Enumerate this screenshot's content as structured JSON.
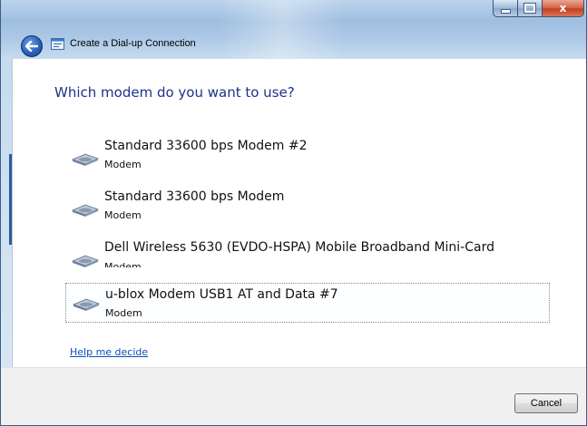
{
  "window": {
    "title": "Create a Dial-up Connection",
    "close_glyph": "x",
    "icons": [
      "back-arrow-icon",
      "network-connection-icon",
      "minimize-icon",
      "maximize-icon",
      "close-icon"
    ]
  },
  "main": {
    "heading": "Which modem do you want to use?",
    "modems": [
      {
        "name": "Standard 33600 bps Modem #2",
        "type": "Modem",
        "selected": false
      },
      {
        "name": "Standard 33600 bps Modem",
        "type": "Modem",
        "selected": false
      },
      {
        "name": "Dell Wireless 5630 (EVDO-HSPA) Mobile Broadband Mini-Card",
        "type": "Modem",
        "selected": false
      },
      {
        "name": "u-blox Modem USB1 AT and Data #7",
        "type": "Modem",
        "selected": true
      }
    ],
    "help_link": "Help me decide"
  },
  "footer": {
    "cancel_label": "Cancel"
  },
  "colors": {
    "heading": "#1e3287",
    "link": "#0a4fba",
    "close_button": "#c4401f"
  }
}
